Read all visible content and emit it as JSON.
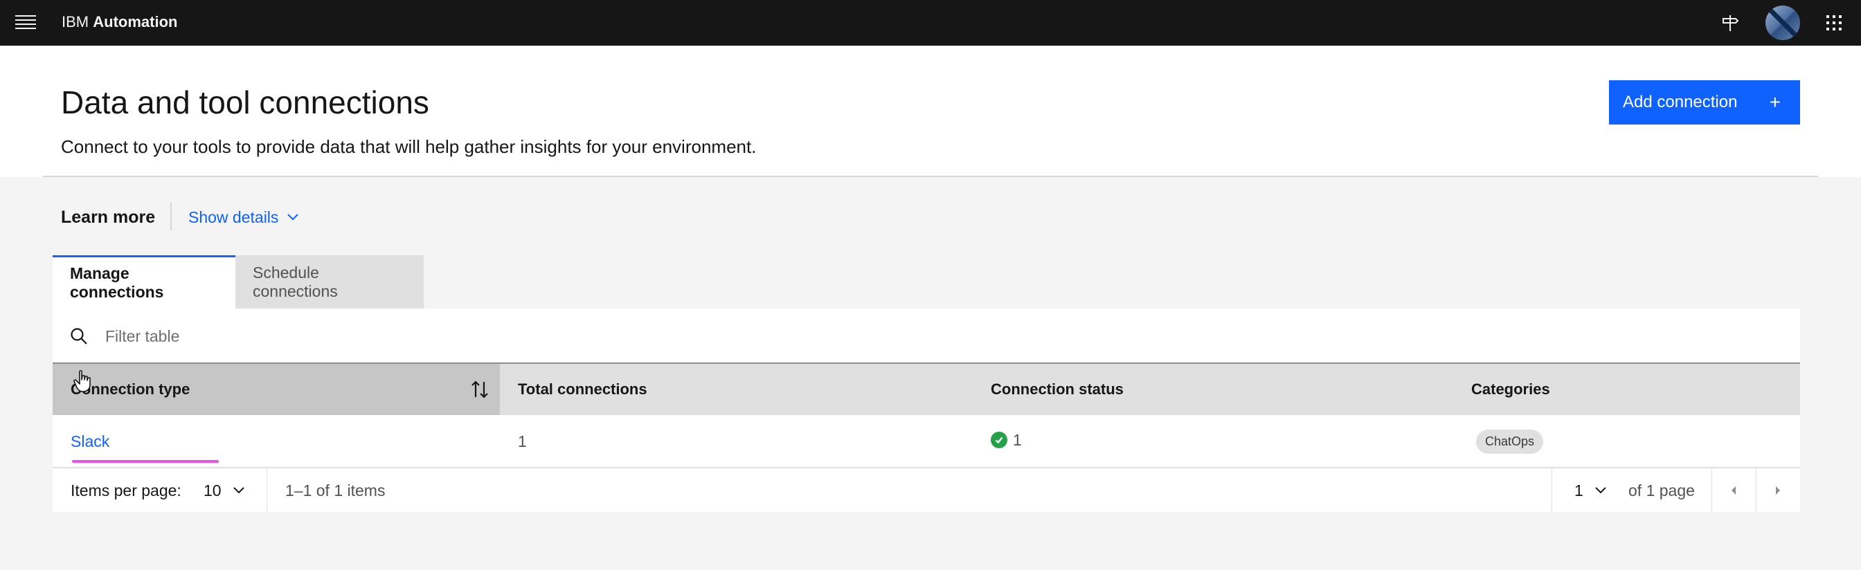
{
  "topbar": {
    "brand_prefix": "IBM",
    "brand_name": "Automation",
    "icons": [
      "menu-icon",
      "signpost-icon",
      "avatar",
      "app-switcher-icon"
    ]
  },
  "header": {
    "title": "Data and tool connections",
    "description": "Connect to your tools to provide data that will help gather insights for your environment.",
    "add_button_label": "Add connection",
    "add_button_icon": "+"
  },
  "learn_more": {
    "label": "Learn more",
    "toggle_label": "Show details"
  },
  "tabs": [
    {
      "label": "Manage connections",
      "active": true
    },
    {
      "label": "Schedule connections",
      "active": false
    }
  ],
  "table": {
    "search_placeholder": "Filter table",
    "columns": [
      "Connection type",
      "Total connections",
      "Connection status",
      "Categories"
    ],
    "rows": [
      {
        "connection_type": "Slack",
        "total_connections": "1",
        "status_count": "1",
        "status": "connected",
        "category": "ChatOps"
      }
    ]
  },
  "pagination": {
    "items_per_page_label": "Items per page:",
    "items_per_page": "10",
    "range_text": "1–1 of 1 items",
    "page": "1",
    "of_pages": "of 1 page"
  },
  "colors": {
    "accent": "#0f62fe",
    "success": "#24a148",
    "topbar": "#161616",
    "annotation": "#ee4fe8"
  }
}
